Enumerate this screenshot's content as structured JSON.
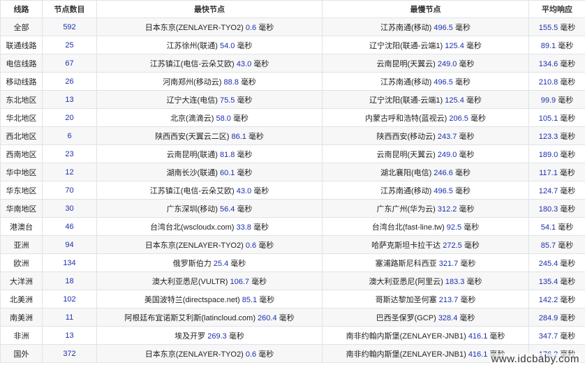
{
  "headers": [
    "线路",
    "节点数目",
    "最快节点",
    "最慢节点",
    "平均响应"
  ],
  "unit": "毫秒",
  "rows": [
    {
      "region": "全部",
      "count": "592",
      "fast_name": "日本东京(ZENLAYER-TYO2)",
      "fast_val": "0.6",
      "slow_name": "江苏南通(移动)",
      "slow_val": "496.5",
      "avg": "155.5"
    },
    {
      "region": "联通线路",
      "count": "25",
      "fast_name": "江苏徐州(联通)",
      "fast_val": "54.0",
      "slow_name": "辽宁沈阳(联通-云端1)",
      "slow_val": "125.4",
      "avg": "89.1"
    },
    {
      "region": "电信线路",
      "count": "67",
      "fast_name": "江苏镇江(电信-云朵艾欧)",
      "fast_val": "43.0",
      "slow_name": "云南昆明(天翼云)",
      "slow_val": "249.0",
      "avg": "134.6"
    },
    {
      "region": "移动线路",
      "count": "26",
      "fast_name": "河南郑州(移动云)",
      "fast_val": "88.8",
      "slow_name": "江苏南通(移动)",
      "slow_val": "496.5",
      "avg": "210.8"
    },
    {
      "region": "东北地区",
      "count": "13",
      "fast_name": "辽宁大连(电信)",
      "fast_val": "75.5",
      "slow_name": "辽宁沈阳(联通-云端1)",
      "slow_val": "125.4",
      "avg": "99.9"
    },
    {
      "region": "华北地区",
      "count": "20",
      "fast_name": "北京(滴滴云)",
      "fast_val": "58.0",
      "slow_name": "内蒙古呼和浩特(蓝视云)",
      "slow_val": "206.5",
      "avg": "105.1"
    },
    {
      "region": "西北地区",
      "count": "6",
      "fast_name": "陕西西安(天翼云二区)",
      "fast_val": "86.1",
      "slow_name": "陕西西安(移动云)",
      "slow_val": "243.7",
      "avg": "123.3"
    },
    {
      "region": "西南地区",
      "count": "23",
      "fast_name": "云南昆明(联通)",
      "fast_val": "81.8",
      "slow_name": "云南昆明(天翼云)",
      "slow_val": "249.0",
      "avg": "189.0"
    },
    {
      "region": "华中地区",
      "count": "12",
      "fast_name": "湖南长沙(联通)",
      "fast_val": "60.1",
      "slow_name": "湖北襄阳(电信)",
      "slow_val": "246.6",
      "avg": "117.1"
    },
    {
      "region": "华东地区",
      "count": "70",
      "fast_name": "江苏镇江(电信-云朵艾欧)",
      "fast_val": "43.0",
      "slow_name": "江苏南通(移动)",
      "slow_val": "496.5",
      "avg": "124.7"
    },
    {
      "region": "华南地区",
      "count": "30",
      "fast_name": "广东深圳(移动)",
      "fast_val": "56.4",
      "slow_name": "广东广州(华为云)",
      "slow_val": "312.2",
      "avg": "180.3"
    },
    {
      "region": "港澳台",
      "count": "46",
      "fast_name": "台湾台北(wscloudx.com)",
      "fast_val": "33.8",
      "slow_name": "台湾台北(fast-line.tw)",
      "slow_val": "92.5",
      "avg": "54.1"
    },
    {
      "region": "亚洲",
      "count": "94",
      "fast_name": "日本东京(ZENLAYER-TYO2)",
      "fast_val": "0.6",
      "slow_name": "哈萨克斯坦卡拉干达",
      "slow_val": "272.5",
      "avg": "85.7"
    },
    {
      "region": "欧洲",
      "count": "134",
      "fast_name": "俄罗斯伯力",
      "fast_val": "25.4",
      "slow_name": "塞浦路斯尼科西亚",
      "slow_val": "321.7",
      "avg": "245.4"
    },
    {
      "region": "大洋洲",
      "count": "18",
      "fast_name": "澳大利亚悉尼(VULTR)",
      "fast_val": "106.7",
      "slow_name": "澳大利亚悉尼(阿里云)",
      "slow_val": "183.3",
      "avg": "135.4"
    },
    {
      "region": "北美洲",
      "count": "102",
      "fast_name": "美国波特兰(directspace.net)",
      "fast_val": "85.1",
      "slow_name": "哥斯达黎加圣何塞",
      "slow_val": "213.7",
      "avg": "142.2"
    },
    {
      "region": "南美洲",
      "count": "11",
      "fast_name": "阿根廷布宜诺斯艾利斯(latincloud.com)",
      "fast_val": "260.4",
      "slow_name": "巴西圣保罗(GCP)",
      "slow_val": "328.4",
      "avg": "284.9"
    },
    {
      "region": "非洲",
      "count": "13",
      "fast_name": "埃及开罗",
      "fast_val": "269.3",
      "slow_name": "南非约翰内斯堡(ZENLAYER-JNB1)",
      "slow_val": "416.1",
      "avg": "347.7"
    },
    {
      "region": "国外",
      "count": "372",
      "fast_name": "日本东京(ZENLAYER-TYO2)",
      "fast_val": "0.6",
      "slow_name": "南非约翰内斯堡(ZENLAYER-JNB1)",
      "slow_val": "416.1",
      "avg": "176.2"
    }
  ],
  "watermark": "www.idcbaby.com",
  "colors": {
    "value": "#1a2fb0",
    "text": "#222222",
    "border": "#dfe3e8",
    "stripe": "#f7f7f7"
  }
}
